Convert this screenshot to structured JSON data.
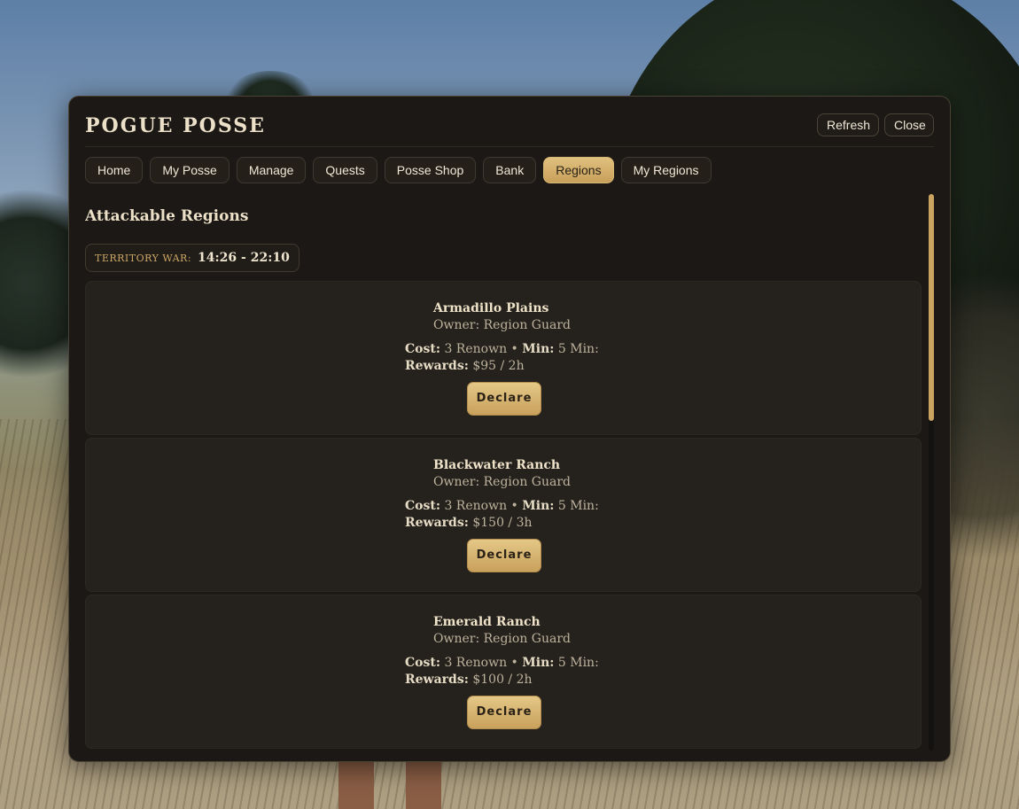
{
  "window": {
    "title": "POGUE POSSE",
    "buttons": {
      "refresh": "Refresh",
      "close": "Close"
    }
  },
  "tabs": [
    {
      "label": "Home"
    },
    {
      "label": "My Posse"
    },
    {
      "label": "Manage"
    },
    {
      "label": "Quests"
    },
    {
      "label": "Posse Shop"
    },
    {
      "label": "Bank"
    },
    {
      "label": "Regions",
      "active": true
    },
    {
      "label": "My Regions"
    }
  ],
  "section": {
    "title": "Attackable Regions",
    "territory_war_label": "TERRITORY WAR:",
    "territory_war_time": "14:26 - 22:10"
  },
  "labels": {
    "cost": "Cost:",
    "min": "Min:",
    "rewards": "Rewards:",
    "declare": "Declare"
  },
  "regions": [
    {
      "name": "Armadillo Plains",
      "owner": "Owner: Region Guard",
      "cost_value": "3 Renown",
      "min_value": "5 Min:",
      "rewards_value": "$95 / 2h"
    },
    {
      "name": "Blackwater Ranch",
      "owner": "Owner: Region Guard",
      "cost_value": "3 Renown",
      "min_value": "5 Min:",
      "rewards_value": "$150 / 3h"
    },
    {
      "name": "Emerald Ranch",
      "owner": "Owner: Region Guard",
      "cost_value": "3 Renown",
      "min_value": "5 Min:",
      "rewards_value": "$100 / 2h"
    }
  ],
  "colors": {
    "accent_gold": "#c9a15c",
    "panel_bg": "#1b1815",
    "card_bg": "#25211c"
  }
}
